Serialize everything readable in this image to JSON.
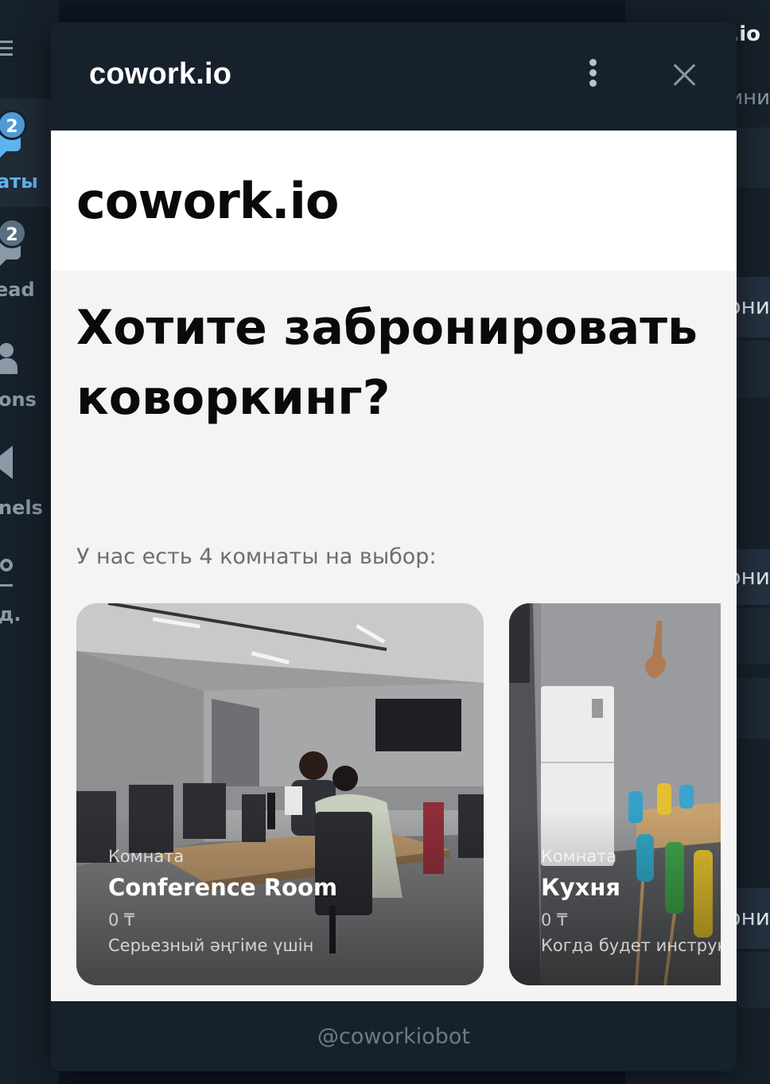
{
  "background_app": {
    "left_nav": [
      {
        "label": "аты",
        "badge": "2",
        "icon": "chats-icon",
        "active": true
      },
      {
        "label": "ead",
        "badge": "2",
        "icon": "unread-icon",
        "active": false
      },
      {
        "label": "ons",
        "badge": "",
        "icon": "person-icon",
        "active": false
      },
      {
        "label": "nels",
        "badge": "",
        "icon": "megaphone-icon",
        "active": false
      },
      {
        "label": "д.",
        "badge": "",
        "icon": "toggle-icon",
        "active": false
      }
    ],
    "right_panel": {
      "title": ".io",
      "snippets": [
        "ини",
        "они",
        "они",
        "они"
      ]
    }
  },
  "mini_app": {
    "window_title": "cowork.io",
    "menu_icon": "kebab-menu-icon",
    "close_icon": "close-icon",
    "site": {
      "logo": "cowork.io",
      "hero_title": "Хотите забронировать коворкинг?",
      "subtitle": "У нас есть 4 комнаты на выбор:",
      "rooms": [
        {
          "kind": "Комната",
          "name": "Conference Room",
          "price": "0 ₸",
          "description": "Серьезный әңгіме үшін"
        },
        {
          "kind": "Комната",
          "name": "Кухня",
          "price": "0 ₸",
          "description": "Когда будет инструк"
        }
      ]
    },
    "footer_bot": "@coworkiobot"
  },
  "colors": {
    "modal_bg": "#17212b",
    "webview_bg": "#f4f4f4",
    "accent_blue": "#5fb4f0",
    "footer_text": "#6c7a89"
  }
}
